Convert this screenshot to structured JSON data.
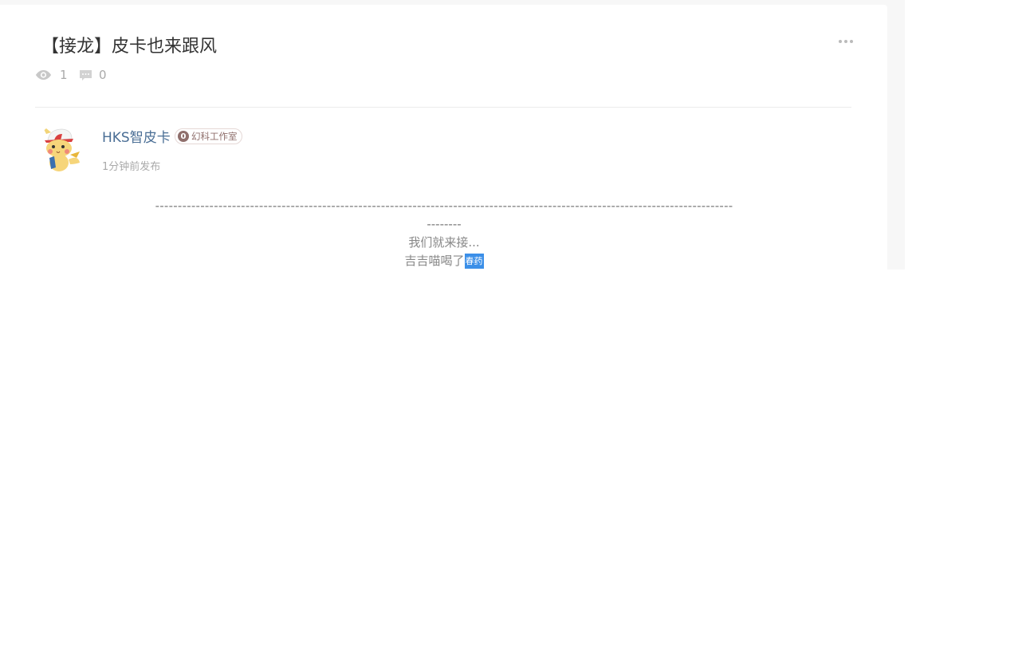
{
  "post": {
    "title": "【接龙】皮卡也来跟风",
    "views": "1",
    "comments": "0"
  },
  "author": {
    "name": "HKS智皮卡",
    "badge_level": "0",
    "badge_label": "幻科工作室",
    "post_time": "1分钟前发布"
  },
  "content": {
    "dash_line_1": "--------------------------------------------------------------------------------------------------------------------------------",
    "dash_line_2": "--------",
    "line_1": "我们就来接...",
    "line_2_prefix": "吉吉喵喝了",
    "line_2_highlight": "春药"
  },
  "icons": {
    "views": "eye-icon",
    "comments": "comment-icon",
    "more": "more-dots-icon"
  },
  "colors": {
    "author_name": "#4a6e95",
    "badge": "#8f6f6c",
    "highlight": "#3b8fe8"
  }
}
